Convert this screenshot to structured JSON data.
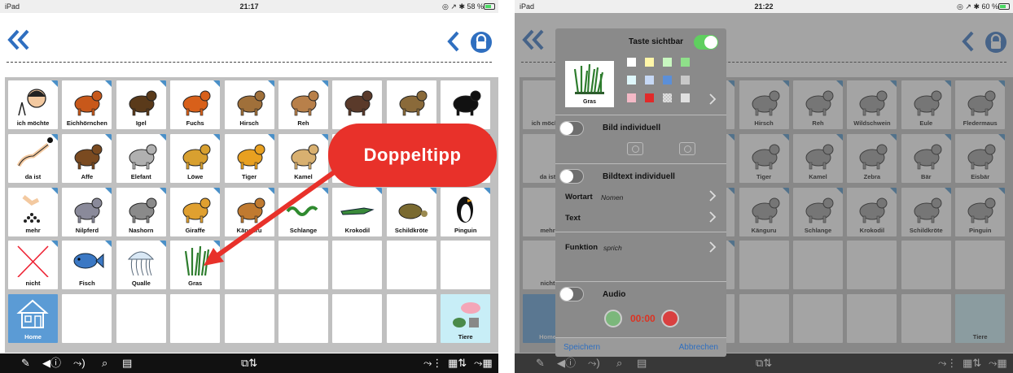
{
  "left": {
    "status": {
      "device": "iPad",
      "time": "21:17",
      "indicators": "◎ ↗ ✱ 58 %"
    },
    "cells": [
      {
        "label": "ich möchte",
        "icon": "person-icon"
      },
      {
        "label": "Eichhörnchen",
        "icon": "squirrel-icon"
      },
      {
        "label": "Igel",
        "icon": "hedgehog-icon"
      },
      {
        "label": "Fuchs",
        "icon": "fox-icon"
      },
      {
        "label": "Hirsch",
        "icon": "deer-icon"
      },
      {
        "label": "Reh",
        "icon": "roe-deer-icon"
      },
      {
        "label": "",
        "icon": "boar-icon"
      },
      {
        "label": "",
        "icon": "owl-icon"
      },
      {
        "label": "",
        "icon": "bat-icon"
      },
      {
        "label": "da ist",
        "icon": "pointing-hand-icon"
      },
      {
        "label": "Affe",
        "icon": "monkey-icon"
      },
      {
        "label": "Elefant",
        "icon": "elephant-icon"
      },
      {
        "label": "Löwe",
        "icon": "lion-icon"
      },
      {
        "label": "Tiger",
        "icon": "tiger-icon"
      },
      {
        "label": "Kamel",
        "icon": "camel-icon"
      },
      {
        "label": "Zebra",
        "icon": "zebra-icon"
      },
      {
        "label": "Bär",
        "icon": "bear-icon"
      },
      {
        "label": "Eisbär",
        "icon": "polar-bear-icon"
      },
      {
        "label": "mehr",
        "icon": "more-icon"
      },
      {
        "label": "Nilpferd",
        "icon": "hippo-icon"
      },
      {
        "label": "Nashorn",
        "icon": "rhino-icon"
      },
      {
        "label": "Giraffe",
        "icon": "giraffe-icon"
      },
      {
        "label": "Känguru",
        "icon": "kangaroo-icon"
      },
      {
        "label": "Schlange",
        "icon": "snake-icon"
      },
      {
        "label": "Krokodil",
        "icon": "crocodile-icon"
      },
      {
        "label": "Schildkröte",
        "icon": "turtle-icon"
      },
      {
        "label": "Pinguin",
        "icon": "penguin-icon"
      },
      {
        "label": "nicht",
        "icon": "cross-icon"
      },
      {
        "label": "Fisch",
        "icon": "fish-icon"
      },
      {
        "label": "Qualle",
        "icon": "jellyfish-icon"
      },
      {
        "label": "Gras",
        "icon": "grass-icon"
      },
      {
        "label": "",
        "icon": ""
      },
      {
        "label": "",
        "icon": ""
      },
      {
        "label": "",
        "icon": ""
      },
      {
        "label": "",
        "icon": ""
      },
      {
        "label": "",
        "icon": ""
      },
      {
        "label": "Home",
        "icon": "house-icon"
      },
      {
        "label": "",
        "icon": ""
      },
      {
        "label": "",
        "icon": ""
      },
      {
        "label": "",
        "icon": ""
      },
      {
        "label": "",
        "icon": ""
      },
      {
        "label": "",
        "icon": ""
      },
      {
        "label": "",
        "icon": ""
      },
      {
        "label": "",
        "icon": ""
      },
      {
        "label": "Tiere",
        "icon": "animals-icon"
      }
    ],
    "callout": "Doppeltipp"
  },
  "right": {
    "status": {
      "device": "iPad",
      "time": "21:22",
      "indicators": "◎ ↗ ✱ 60 %"
    },
    "cells": [
      {
        "label": "ich möchte"
      },
      {
        "label": ""
      },
      {
        "label": ""
      },
      {
        "label": "Fuchs"
      },
      {
        "label": "Hirsch"
      },
      {
        "label": "Reh"
      },
      {
        "label": "Wildschwein"
      },
      {
        "label": "Eule"
      },
      {
        "label": "Fledermaus"
      },
      {
        "label": "da ist"
      },
      {
        "label": ""
      },
      {
        "label": ""
      },
      {
        "label": "Löwe"
      },
      {
        "label": "Tiger"
      },
      {
        "label": "Kamel"
      },
      {
        "label": "Zebra"
      },
      {
        "label": "Bär"
      },
      {
        "label": "Eisbär"
      },
      {
        "label": "mehr"
      },
      {
        "label": ""
      },
      {
        "label": ""
      },
      {
        "label": "Giraffe"
      },
      {
        "label": "Känguru"
      },
      {
        "label": "Schlange"
      },
      {
        "label": "Krokodil"
      },
      {
        "label": "Schildkröte"
      },
      {
        "label": "Pinguin"
      },
      {
        "label": "nicht"
      },
      {
        "label": ""
      },
      {
        "label": ""
      },
      {
        "label": "Gras"
      },
      {
        "label": ""
      },
      {
        "label": ""
      },
      {
        "label": ""
      },
      {
        "label": ""
      },
      {
        "label": ""
      },
      {
        "label": "Home"
      },
      {
        "label": ""
      },
      {
        "label": ""
      },
      {
        "label": ""
      },
      {
        "label": ""
      },
      {
        "label": ""
      },
      {
        "label": ""
      },
      {
        "label": ""
      },
      {
        "label": "Tiere"
      }
    ],
    "panel": {
      "visible_label": "Taste sichtbar",
      "thumb_label": "Gras",
      "bild_label": "Bild individuell",
      "bildtext_label": "Bildtext individuell",
      "wortart_label": "Wortart",
      "wortart_value": "Nomen",
      "text_label": "Text",
      "funktion_label": "Funktion",
      "funktion_value": "sprich",
      "audio_label": "Audio",
      "timer": "00:00",
      "save_label": "Speichern",
      "cancel_label": "Abbrechen",
      "swatches": [
        "#ffffff",
        "#fff6a8",
        "#c8f7c0",
        "#8fe08a",
        "#dff7fb",
        "#c6d8f5",
        "#5b8fd8",
        "#c8c8c8",
        "#f4b9c6",
        "#e12a2a",
        "checker",
        "#e0e0e0"
      ]
    }
  },
  "colors": {
    "accent": "#4a90c8",
    "callout": "#e8312a",
    "toggle_on": "#5fcf5f"
  }
}
